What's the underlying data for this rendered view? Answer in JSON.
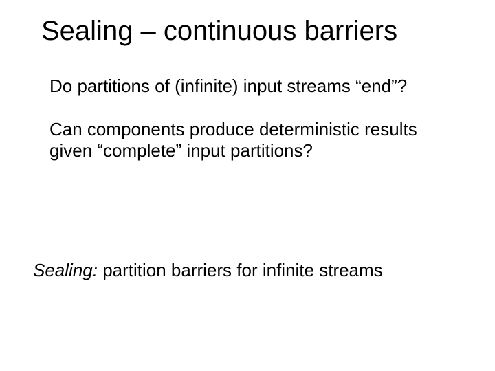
{
  "title": "Sealing – continuous barriers",
  "body": {
    "p1": "Do partitions of (infinite) input streams “end”?",
    "p2": "Can components produce deterministic results given “complete” input partitions?"
  },
  "footer": {
    "label": "Sealing:",
    "rest": " partition barriers for infinite streams"
  }
}
